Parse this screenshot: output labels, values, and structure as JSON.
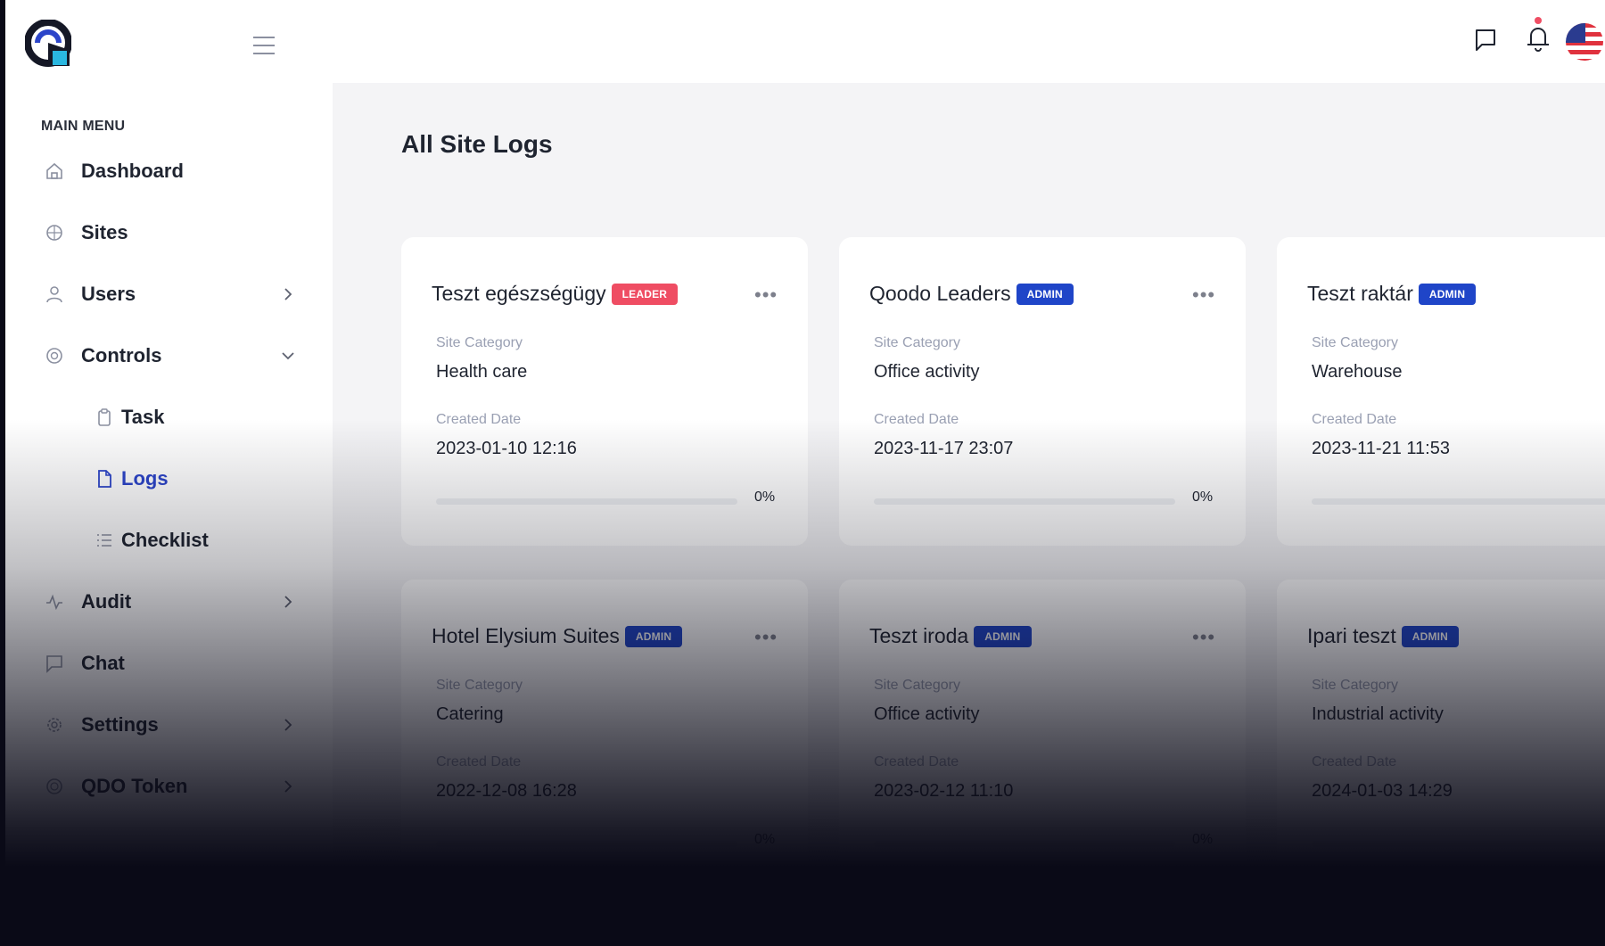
{
  "sidebar": {
    "menu_title": "MAIN MENU",
    "items": [
      {
        "label": "Dashboard",
        "icon": "home-icon"
      },
      {
        "label": "Sites",
        "icon": "globe-icon"
      },
      {
        "label": "Users",
        "icon": "user-icon"
      },
      {
        "label": "Controls",
        "icon": "aperture-icon"
      },
      {
        "label": "Task",
        "icon": "clipboard-icon"
      },
      {
        "label": "Logs",
        "icon": "file-icon"
      },
      {
        "label": "Checklist",
        "icon": "list-icon"
      },
      {
        "label": "Audit",
        "icon": "activity-icon"
      },
      {
        "label": "Chat",
        "icon": "chat-icon"
      },
      {
        "label": "Settings",
        "icon": "gear-icon"
      },
      {
        "label": "QDO Token",
        "icon": "token-icon"
      }
    ],
    "active_item": "Logs",
    "accent_color": "#2c45c9"
  },
  "main": {
    "title": "All Site Logs",
    "field_labels": {
      "category": "Site Category",
      "created": "Created Date"
    },
    "cards": [
      {
        "title": "Teszt egészségügy",
        "badge": "LEADER",
        "category": "Health care",
        "created": "2023-01-10 12:16",
        "progress": 0,
        "progress_label": "0%"
      },
      {
        "title": "Qoodo Leaders",
        "badge": "ADMIN",
        "category": "Office activity",
        "created": "2023-11-17 23:07",
        "progress": 0,
        "progress_label": "0%"
      },
      {
        "title": "Teszt raktár",
        "badge": "ADMIN",
        "category": "Warehouse",
        "created": "2023-11-21 11:53",
        "progress": 0,
        "progress_label": ""
      },
      {
        "title": "Hotel Elysium Suites",
        "badge": "ADMIN",
        "category": "Catering",
        "created": "2022-12-08 16:28",
        "progress": 0,
        "progress_label": "0%"
      },
      {
        "title": "Teszt iroda",
        "badge": "ADMIN",
        "category": "Office activity",
        "created": "2023-02-12 11:10",
        "progress": 0,
        "progress_label": "0%"
      },
      {
        "title": "Ipari teszt",
        "badge": "ADMIN",
        "category": "Industrial activity",
        "created": "2024-01-03 14:29",
        "progress": 0,
        "progress_label": ""
      }
    ]
  },
  "colors": {
    "leader_badge": "#ef4d63",
    "admin_badge": "#1f45c8",
    "notification_dot": "#ef4d63"
  }
}
